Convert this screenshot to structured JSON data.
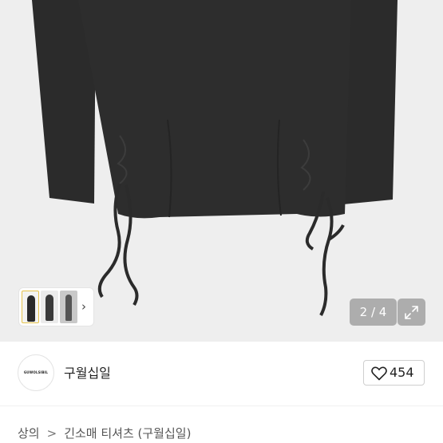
{
  "gallery": {
    "page_current": "2",
    "page_total": "4",
    "page_separator": " / ",
    "main_image_icon": "long-sleeve-drawstring-shirt-image",
    "thumbnail_next_icon": "chevron-right-icon",
    "expand_icon": "expand-arrows-icon"
  },
  "seller": {
    "name": "구월십일",
    "avatar_logo_text": "GUWOLSIBIL",
    "like_icon": "heart-icon",
    "like_count": "454"
  },
  "breadcrumb": {
    "items": [
      "상의",
      "긴소매 티셔츠 (구월십일)"
    ],
    "separator": ">"
  },
  "colors": {
    "photo_background": "#eeeeee",
    "garment": "#2b2b2b",
    "overlay": "#787878"
  }
}
